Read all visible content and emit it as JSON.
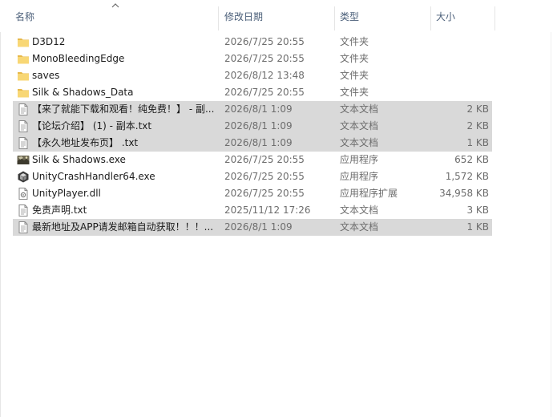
{
  "columns": {
    "name": "名称",
    "date": "修改日期",
    "type": "类型",
    "size": "大小"
  },
  "files": [
    {
      "name": "D3D12",
      "date": "2026/7/25 20:55",
      "type": "文件夹",
      "size": "",
      "icon": "folder-icon",
      "selected": false
    },
    {
      "name": "MonoBleedingEdge",
      "date": "2026/7/25 20:55",
      "type": "文件夹",
      "size": "",
      "icon": "folder-icon",
      "selected": false
    },
    {
      "name": "saves",
      "date": "2026/8/12 13:48",
      "type": "文件夹",
      "size": "",
      "icon": "folder-icon",
      "selected": false
    },
    {
      "name": "Silk & Shadows_Data",
      "date": "2026/7/25 20:55",
      "type": "文件夹",
      "size": "",
      "icon": "folder-icon",
      "selected": false
    },
    {
      "name": "【来了就能下载和观看！纯免费！】 - 副...",
      "date": "2026/8/1 1:09",
      "type": "文本文档",
      "size": "2 KB",
      "icon": "text-file-icon",
      "selected": true
    },
    {
      "name": "【论坛介绍】 (1) - 副本.txt",
      "date": "2026/8/1 1:09",
      "type": "文本文档",
      "size": "2 KB",
      "icon": "text-file-icon",
      "selected": true
    },
    {
      "name": "【永久地址发布页】 .txt",
      "date": "2026/8/1 1:09",
      "type": "文本文档",
      "size": "1 KB",
      "icon": "text-file-icon",
      "selected": true
    },
    {
      "name": "Silk & Shadows.exe",
      "date": "2026/7/25 20:55",
      "type": "应用程序",
      "size": "652 KB",
      "icon": "game-exe-icon",
      "selected": false
    },
    {
      "name": "UnityCrashHandler64.exe",
      "date": "2026/7/25 20:55",
      "type": "应用程序",
      "size": "1,572 KB",
      "icon": "unity-icon",
      "selected": false
    },
    {
      "name": "UnityPlayer.dll",
      "date": "2026/7/25 20:55",
      "type": "应用程序扩展",
      "size": "34,958 KB",
      "icon": "dll-file-icon",
      "selected": false
    },
    {
      "name": "免责声明.txt",
      "date": "2025/11/12 17:26",
      "type": "文本文档",
      "size": "3 KB",
      "icon": "text-file-icon",
      "selected": false
    },
    {
      "name": "最新地址及APP请发邮箱自动获取！！！...",
      "date": "2026/8/1 1:09",
      "type": "文本文档",
      "size": "1 KB",
      "icon": "text-file-icon",
      "selected": true
    }
  ],
  "colors": {
    "folder": "#f8d775",
    "folder_dark": "#e7b94a",
    "selection": "#d9d9d9",
    "header_text": "#4c607a",
    "meta_text": "#6d6d6d"
  }
}
